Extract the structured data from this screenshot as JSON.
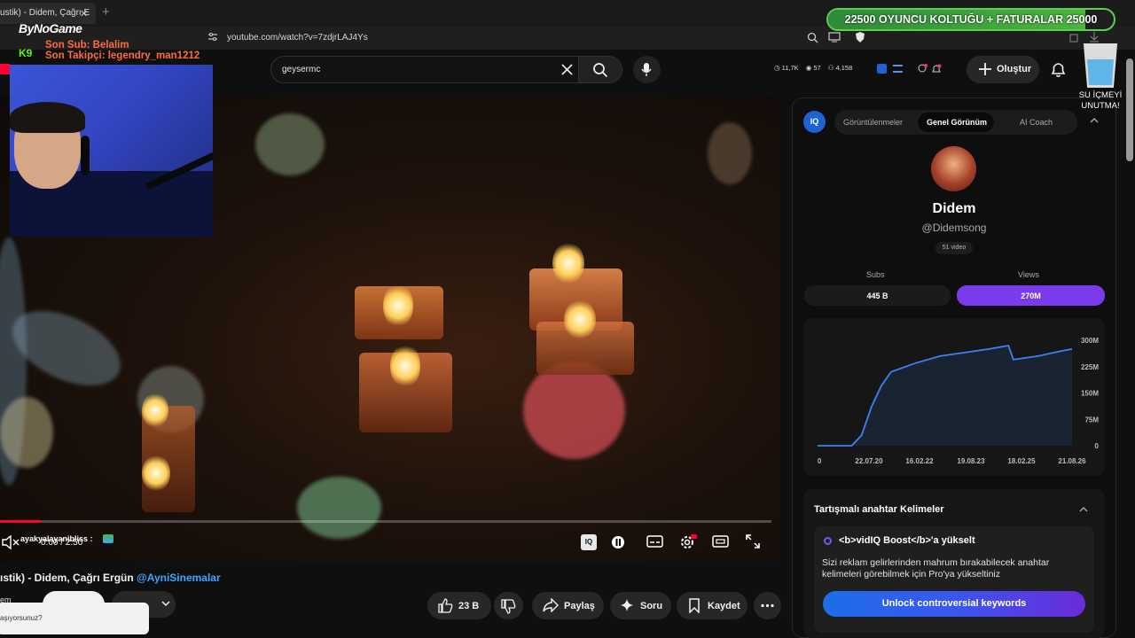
{
  "browser": {
    "tab_title": "ustik) - Didem, Çağrı E",
    "tab_close": "✕",
    "new_tab": "+",
    "url": "youtube.com/watch?v=7zdjrLAJ4Ys"
  },
  "header": {
    "search_value": "geysermc",
    "create_label": "Oluştur",
    "stats": [
      "11,7K",
      "57",
      "4,158"
    ]
  },
  "overlay": {
    "brand": "ByNoGame",
    "kick_badge": "K9",
    "last_sub": "Son Sub: Belalim",
    "last_follower": "Son Takipçi: legendry_man1212",
    "goal_current": "22500",
    "goal_label": "OYUNCU KOLTUĞU + FATURALAR",
    "goal_target": "25000",
    "goal_progress": 0.9,
    "water_reminder_line1": "SU İÇMEYİ",
    "water_reminder_line2": "UNUTMA!"
  },
  "player": {
    "time": "0:00 / 2:50",
    "chat_user": "ayakyalayanibliss :",
    "progress": 0.053
  },
  "video": {
    "title_prefix": "ıstik) - Didem, Çağrı Ergün",
    "title_link": "@AyniSinemalar",
    "channel_short": "em",
    "likes": "23 B",
    "share_label": "Paylaş",
    "ask_label": "Soru",
    "save_label": "Kaydet",
    "popup_text": "aşıyorsunuz?"
  },
  "vidiq": {
    "tabs": [
      "Görüntülenmeler",
      "Genel Görünüm",
      "AI Coach"
    ],
    "active_tab": "Genel Görünüm",
    "channel_name": "Didem",
    "channel_handle": "@Didemsong",
    "video_count": "51 video",
    "subs_label": "Subs",
    "subs_value": "445 B",
    "views_label": "Views",
    "views_value": "270M",
    "keywords_title": "Tartışmalı anahtar Kelimeler",
    "boost_title": "<b>vidIQ Boost</b>'a yükselt",
    "boost_desc": "Sizi reklam gelirlerinden mahrum bırakabilecek anahtar kelimeleri görebilmek için Pro'ya yükseltiniz",
    "unlock_label": "Unlock controversial keywords",
    "logo_text": "IQ"
  },
  "chart_data": {
    "type": "line",
    "x_tick_labels": [
      "0",
      "22.07.20",
      "16.02.22",
      "19.08.23",
      "18.02.25",
      "21.08.26"
    ],
    "y_tick_labels": [
      "300M",
      "225M",
      "150M",
      "75M",
      "0"
    ],
    "ylim": [
      0,
      300
    ],
    "x": [
      0,
      0.7,
      0.9,
      1.1,
      1.3,
      1.5,
      2.0,
      2.5,
      3.0,
      3.5,
      3.9,
      4.0,
      4.5,
      5.0,
      5.2
    ],
    "y": [
      0,
      0,
      30,
      110,
      170,
      210,
      235,
      255,
      265,
      275,
      285,
      245,
      255,
      270,
      275
    ],
    "color": "#3b82f6",
    "grid": false
  },
  "colors": {
    "accent_purple": "#7c3aed",
    "youtube_red": "#ff0033",
    "goal_green": "#59d14b"
  }
}
